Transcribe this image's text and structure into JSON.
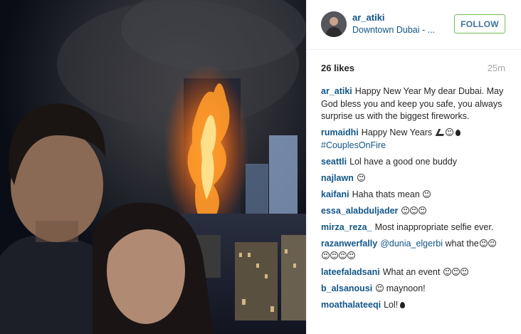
{
  "post": {
    "username": "ar_atiki",
    "location": "Downtown Dubai - ...",
    "follow_label": "FOLLOW",
    "likes": "26 likes",
    "time_ago": "25m"
  },
  "caption": {
    "user": "ar_atiki",
    "text": "Happy New Year My dear Dubai. May God bless you and keep you safe, you always surprise us with the biggest fireworks."
  },
  "comments": [
    {
      "user": "rumaidhi",
      "text": "Happy New Years",
      "tag": "#CouplesOnFire",
      "icons": [
        "hand-gesture-icon",
        "smiley-emoji-icon",
        "drop-icon"
      ]
    },
    {
      "user": "seattli",
      "text": "Lol have a good one buddy"
    },
    {
      "user": "najlawn",
      "text": "",
      "icons": [
        "smiley-emoji-icon"
      ]
    },
    {
      "user": "kaifani",
      "text": "Haha thats mean",
      "icons": [
        "smiley-emoji-icon"
      ]
    },
    {
      "user": "essa_alabduljader",
      "text": "",
      "icons": [
        "smiley-emoji-icon",
        "smiley-emoji-icon",
        "smiley-emoji-icon"
      ]
    },
    {
      "user": "mirza_reza_",
      "text": "Most inappropriate selfie ever."
    },
    {
      "user": "razanwerfally",
      "mention": "@dunia_elgerbi",
      "text": "what the",
      "icons": [
        "smiley-emoji-icon x6"
      ]
    },
    {
      "user": "lateefaladsani",
      "text": "What an event",
      "icons": [
        "smiley-emoji-icon",
        "smiley-emoji-icon",
        "smiley-emoji-icon"
      ]
    },
    {
      "user": "b_alsanousi",
      "text": "maynoon!",
      "icons": [
        "smiley-emoji-icon"
      ]
    },
    {
      "user": "moathalateeqi",
      "text": "Lol!",
      "icons": [
        "drop-icon"
      ]
    }
  ],
  "colors": {
    "username": "#125688",
    "follow_border": "#70c050",
    "follow_text": "#3f729b",
    "time": "#a5a7aa",
    "fire": "#ff8a1e"
  }
}
